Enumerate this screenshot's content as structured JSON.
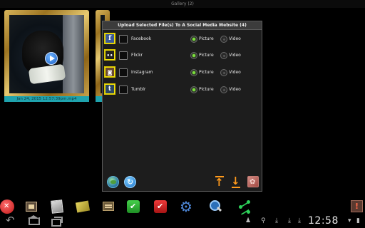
{
  "titlebar": {
    "title": "Gallery (2)"
  },
  "gallery": {
    "items": [
      {
        "caption": "Jan 24, 2015 12:57:39pm.mp4",
        "type": "video"
      },
      {
        "caption": "",
        "type": "video"
      }
    ]
  },
  "dialog": {
    "title": "Upload Selected File(s) To A Social Media Website (4)",
    "picture_label": "Picture",
    "video_label": "Video",
    "networks": [
      {
        "name": "Facebook",
        "icon": "facebook-icon",
        "glyph": "f",
        "checked": false,
        "selected": "Picture"
      },
      {
        "name": "Flickr",
        "icon": "flickr-icon",
        "glyph": "••",
        "checked": false,
        "selected": "Picture"
      },
      {
        "name": "Instagram",
        "icon": "instagram-icon",
        "glyph": "◙",
        "checked": false,
        "selected": "Picture"
      },
      {
        "name": "Tumblr",
        "icon": "tumblr-icon",
        "glyph": "t",
        "checked": false,
        "selected": "Picture"
      }
    ],
    "buttons": [
      "globe-icon",
      "refresh-icon",
      "move-top-icon",
      "move-bottom-icon",
      "gallery-icon"
    ]
  },
  "status": {
    "time": "12:58"
  },
  "colors": {
    "accent": "#1fa3ae",
    "radio_selected": "#7ce23c",
    "arrow": "#ff9a1c",
    "dialog_bg": "#1d1d1d"
  }
}
